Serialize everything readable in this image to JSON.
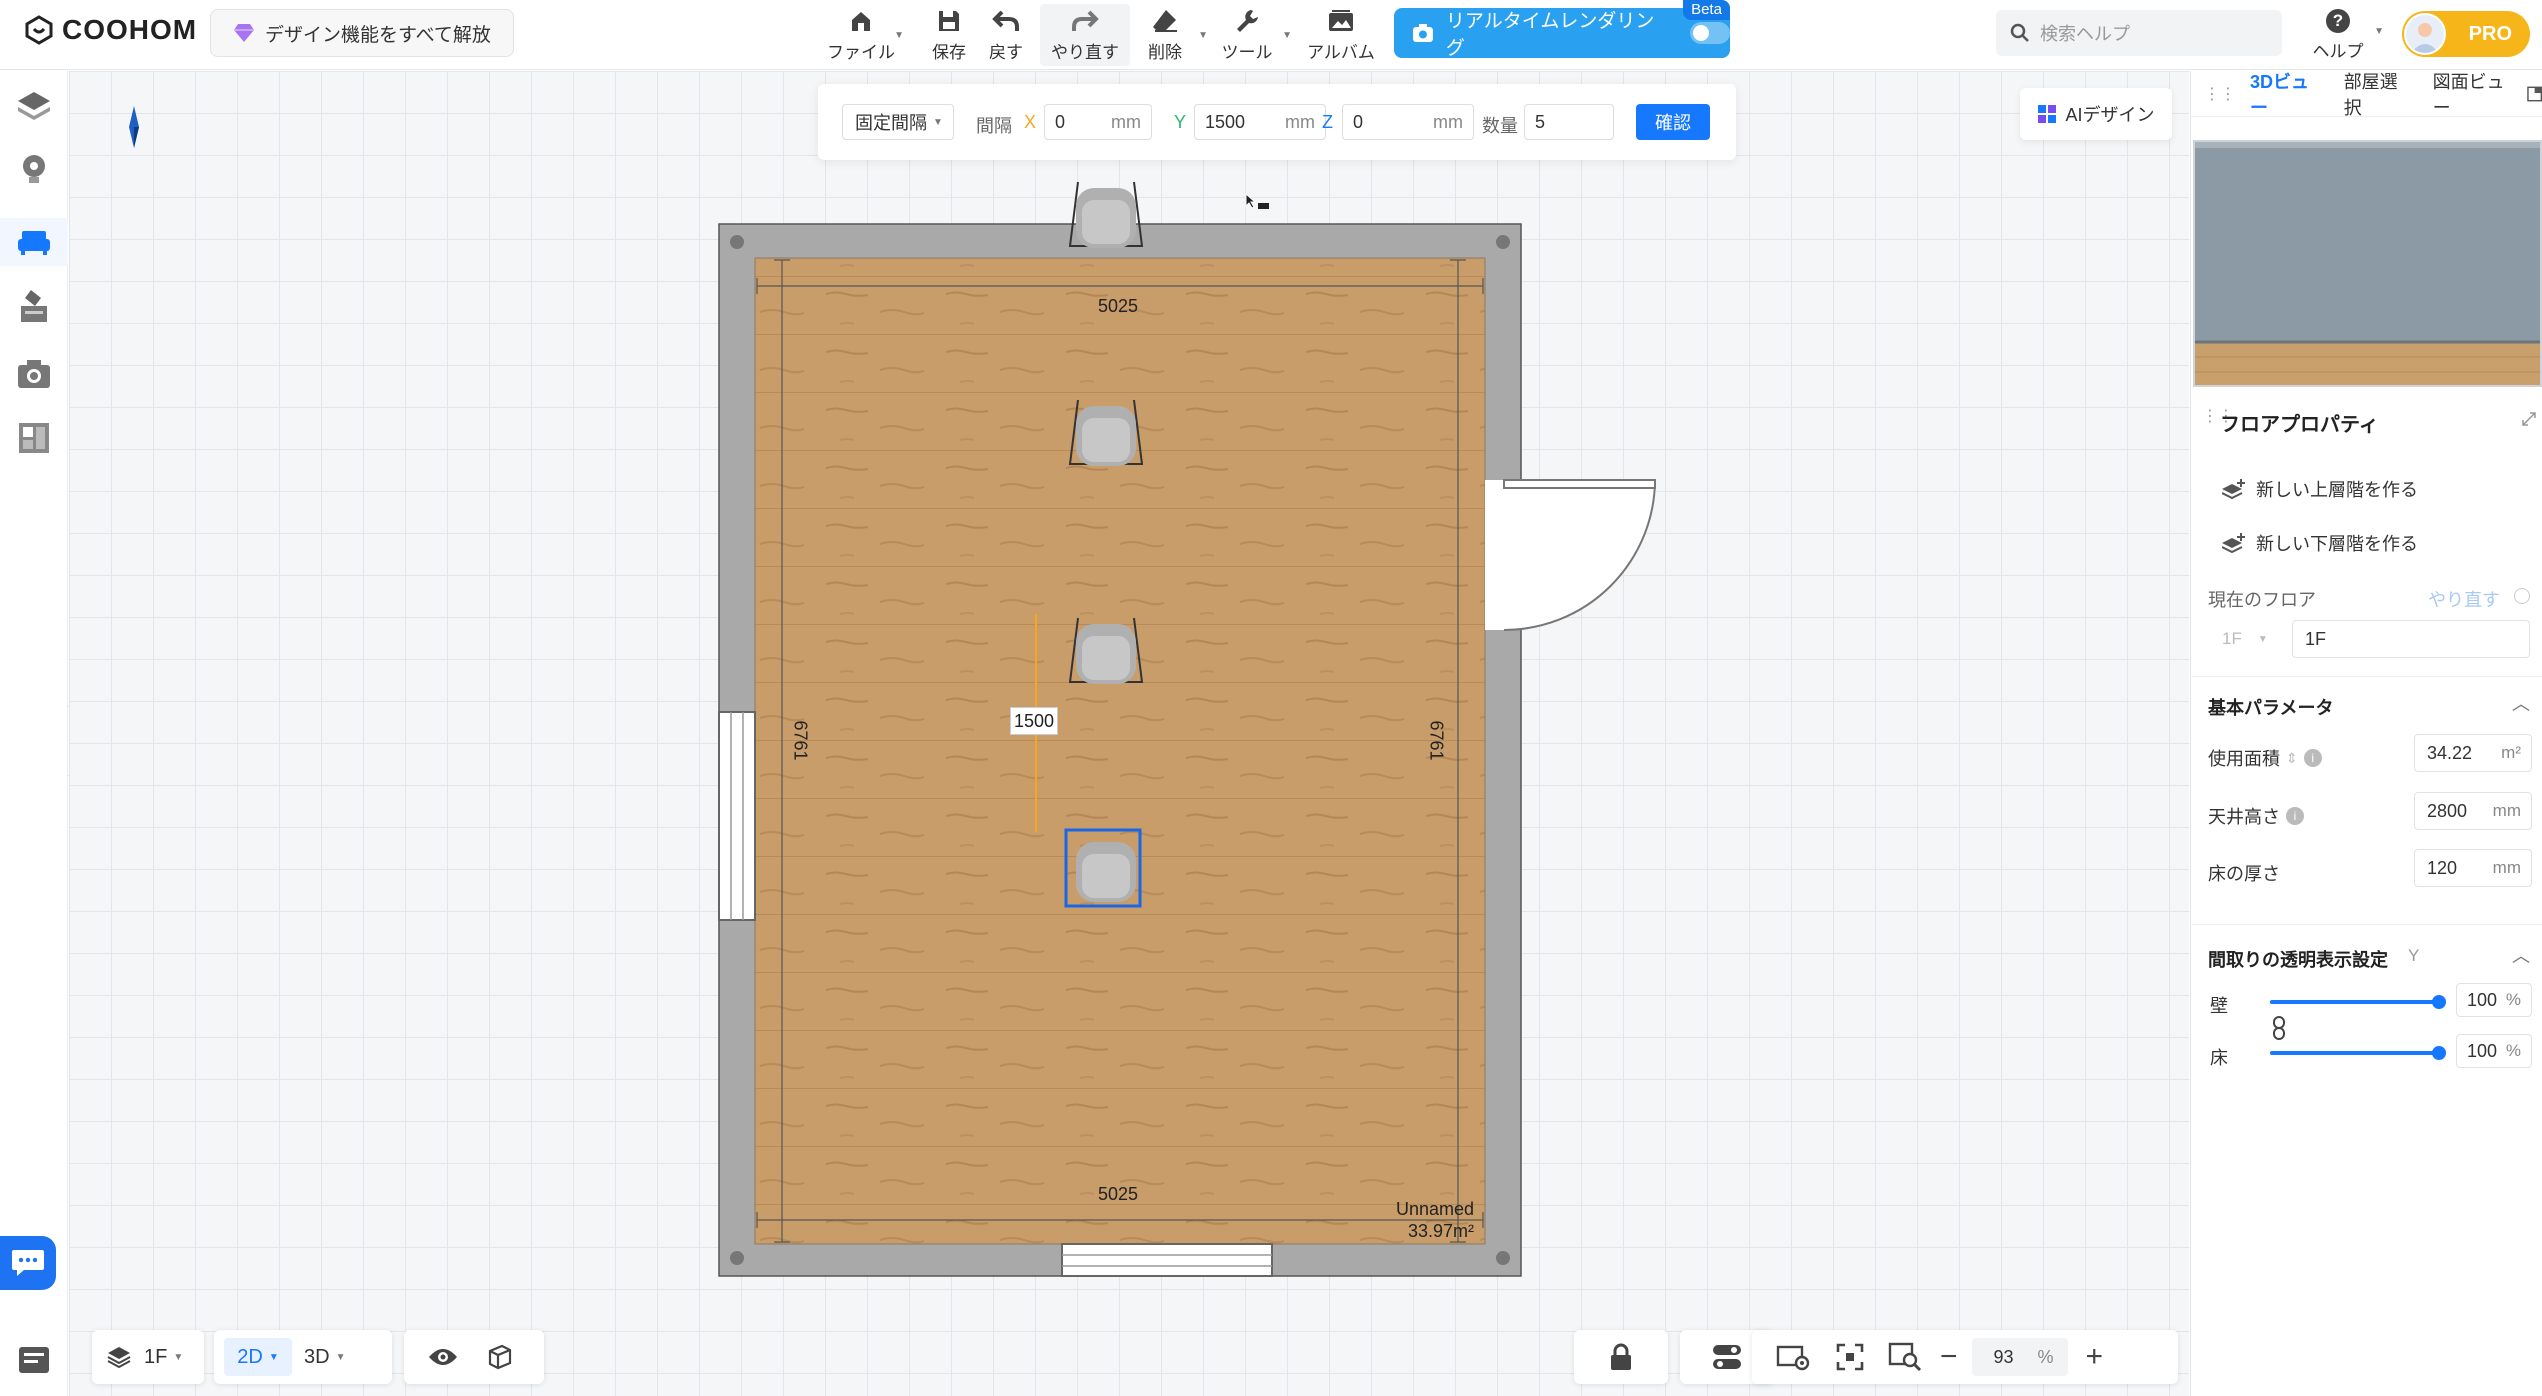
{
  "app": {
    "logo": "COOHOM",
    "unlock_label": "デザイン機能をすべて解放"
  },
  "toolbar": {
    "file": "ファイル",
    "save": "保存",
    "undo": "戻す",
    "redo": "やり直す",
    "delete": "削除",
    "tools": "ツール",
    "album": "アルバム",
    "render": "リアルタイムレンダリング",
    "beta": "Beta"
  },
  "search": {
    "placeholder": "検索ヘルプ"
  },
  "help": {
    "label": "ヘルプ"
  },
  "pro": {
    "label": "PRO"
  },
  "array_bar": {
    "mode": "固定間隔",
    "spacing_label": "間隔",
    "x_axis": "X",
    "x_value": "0",
    "y_axis": "Y",
    "y_value": "1500",
    "z_axis": "Z",
    "z_value": "0",
    "unit": "mm",
    "count_label": "数量",
    "count_value": "5",
    "confirm": "確認"
  },
  "ai_design": {
    "label": "AIデザイン"
  },
  "plan": {
    "top_dim": "5025",
    "bottom_dim": "5025",
    "left_dim": "6761",
    "right_dim": "6761",
    "spacing_dim": "1500",
    "room_name": "Unnamed",
    "room_area": "33.97m²"
  },
  "right_panel": {
    "tabs": [
      "3Dビュー",
      "部屋選択",
      "図面ビュー"
    ],
    "title": "フロアプロパティ",
    "new_upper": "新しい上層階を作る",
    "new_lower": "新しい下層階を作る",
    "current_floor_label": "現在のフロア",
    "redo_label": "やり直す",
    "floor_prefix": "1F",
    "floor_value": "1F",
    "basic_params": "基本パラメータ",
    "area_label": "使用面積",
    "area_value": "34.22",
    "area_unit": "m²",
    "ceiling_label": "天井高さ",
    "ceiling_value": "2800",
    "ceiling_unit": "mm",
    "floor_thick_label": "床の厚さ",
    "floor_thick_value": "120",
    "floor_thick_unit": "mm",
    "transparency_label": "間取りの透明表示設定",
    "transparency_key": "Y",
    "wall_label": "壁",
    "wall_value": "100",
    "wall_fill": 1.0,
    "floor_label": "床",
    "floor_value2": "100",
    "floor_fill": 1.0,
    "percent": "%"
  },
  "bottom": {
    "floor": "1F",
    "mode_2d": "2D",
    "mode_3d": "3D",
    "zoom_value": "93",
    "zoom_unit": "%"
  },
  "colors": {
    "accent": "#1677ff",
    "render": "#2aa0f0",
    "pro": "#f6b519",
    "wall": "#a9a9a9",
    "floor": "#c89d6a"
  }
}
